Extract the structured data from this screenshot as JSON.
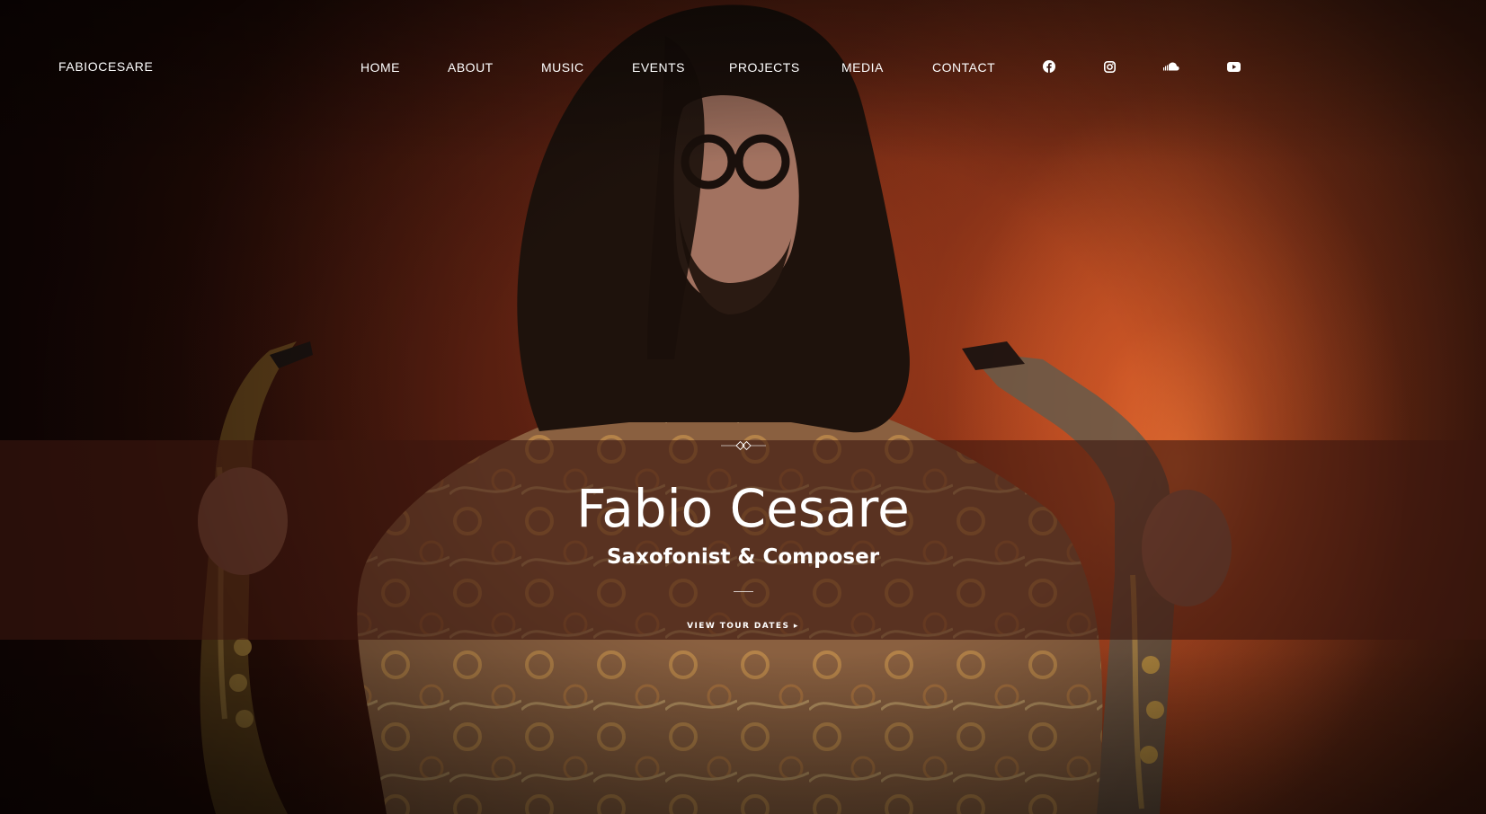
{
  "site": {
    "logo": "FABIOCESARE"
  },
  "nav": {
    "items": [
      {
        "label": "HOME"
      },
      {
        "label": "ABOUT"
      },
      {
        "label": "MUSIC"
      },
      {
        "label": "EVENTS"
      },
      {
        "label": "PROJECTS"
      },
      {
        "label": "MEDIA"
      },
      {
        "label": "CONTACT"
      }
    ],
    "social": [
      {
        "icon": "facebook-icon"
      },
      {
        "icon": "instagram-icon"
      },
      {
        "icon": "soundcloud-icon"
      },
      {
        "icon": "youtube-icon"
      }
    ]
  },
  "hero": {
    "title": "Fabio Cesare",
    "subtitle": "Saxofonist & Composer",
    "cta_label": "VIEW TOUR DATES ▸"
  },
  "colors": {
    "text": "#ffffff",
    "band": "#3c160e",
    "background_accent": "#d85a28"
  }
}
